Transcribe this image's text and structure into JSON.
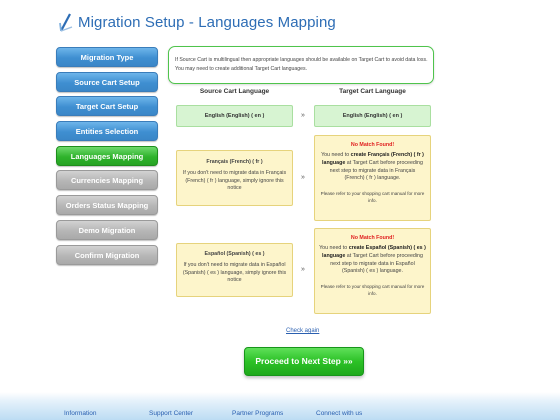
{
  "header": {
    "title": "Migration Setup - Languages Mapping",
    "logo_icon": "migration-logo-icon"
  },
  "sidebar": {
    "items": [
      {
        "label": "Migration Type",
        "state": "blue"
      },
      {
        "label": "Source Cart Setup",
        "state": "blue"
      },
      {
        "label": "Target Cart Setup",
        "state": "blue"
      },
      {
        "label": "Entities Selection",
        "state": "blue"
      },
      {
        "label": "Languages Mapping",
        "state": "green"
      },
      {
        "label": "Currencies Mapping",
        "state": "gray"
      },
      {
        "label": "Orders Status Mapping",
        "state": "gray"
      },
      {
        "label": "Demo Migration",
        "state": "gray"
      },
      {
        "label": "Confirm Migration",
        "state": "gray"
      }
    ]
  },
  "info": {
    "line1": "If Source Cart is multilingual then appropriate languages should be available on Target Cart to avoid data loss.",
    "line2": "You may need to create additional Target Cart languages."
  },
  "columns": {
    "source": "Source Cart Language",
    "target": "Target Cart Language"
  },
  "mappings": {
    "english": {
      "source": "English (English) ( en )",
      "arrow": "»",
      "target": "English (English) ( en )"
    },
    "french": {
      "source_name": "Français (French) ( fr )",
      "source_note": "If you don't need to migrate data in Français (French) ( fr ) language, simply ignore this notice",
      "arrow": "»",
      "nomatch": "No Match Found!",
      "need_pre": "You need to",
      "need_bold": "create Français (French) ( fr ) language",
      "need_post": "at Target Cart before proceeding next step to migrate data in Français (French) ( fr ) language.",
      "refer": "Please refer to your shopping cart manual for more info."
    },
    "spanish": {
      "source_name": "Español (Spanish) ( es )",
      "source_note": "If you don't need to migrate data in Español (Spanish) ( es ) language, simply ignore this notice",
      "arrow": "»",
      "nomatch": "No Match Found!",
      "need_pre": "You need to",
      "need_bold": "create Español (Spanish) ( es ) language",
      "need_post": "at Target Cart before proceeding next step to migrate data in Español (Spanish) ( es ) language.",
      "refer": "Please refer to your shopping cart manual for more info."
    }
  },
  "actions": {
    "check_again": "Check again",
    "proceed": "Proceed to Next Step »»"
  },
  "footer": {
    "links": [
      "Information",
      "Support Center",
      "Partner Programs",
      "Connect with us"
    ]
  },
  "colors": {
    "title_blue": "#2d6db5",
    "nav_blue": "#3f8fd1",
    "nav_green": "#2fb32c",
    "nav_gray": "#b6b6b6",
    "nomatch_red": "#e02020"
  }
}
